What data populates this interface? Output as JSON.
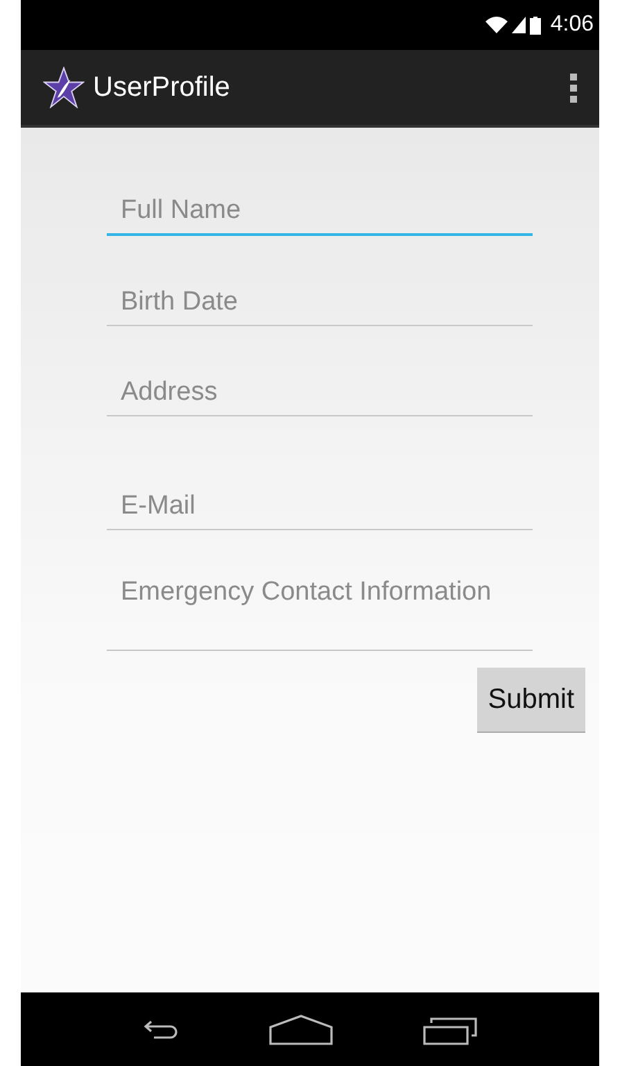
{
  "status_bar": {
    "time": "4:06"
  },
  "action_bar": {
    "title": "UserProfile"
  },
  "fields": [
    {
      "placeholder": "Full Name",
      "kind": "single",
      "focused": true
    },
    {
      "placeholder": "Birth Date",
      "kind": "single",
      "focused": false
    },
    {
      "placeholder": "Address",
      "kind": "single",
      "focused": false
    },
    {
      "placeholder": "E-Mail",
      "kind": "single",
      "focused": false
    },
    {
      "placeholder": "Emergency Contact Information",
      "kind": "multi",
      "focused": false
    }
  ],
  "buttons": [
    "Submit"
  ]
}
